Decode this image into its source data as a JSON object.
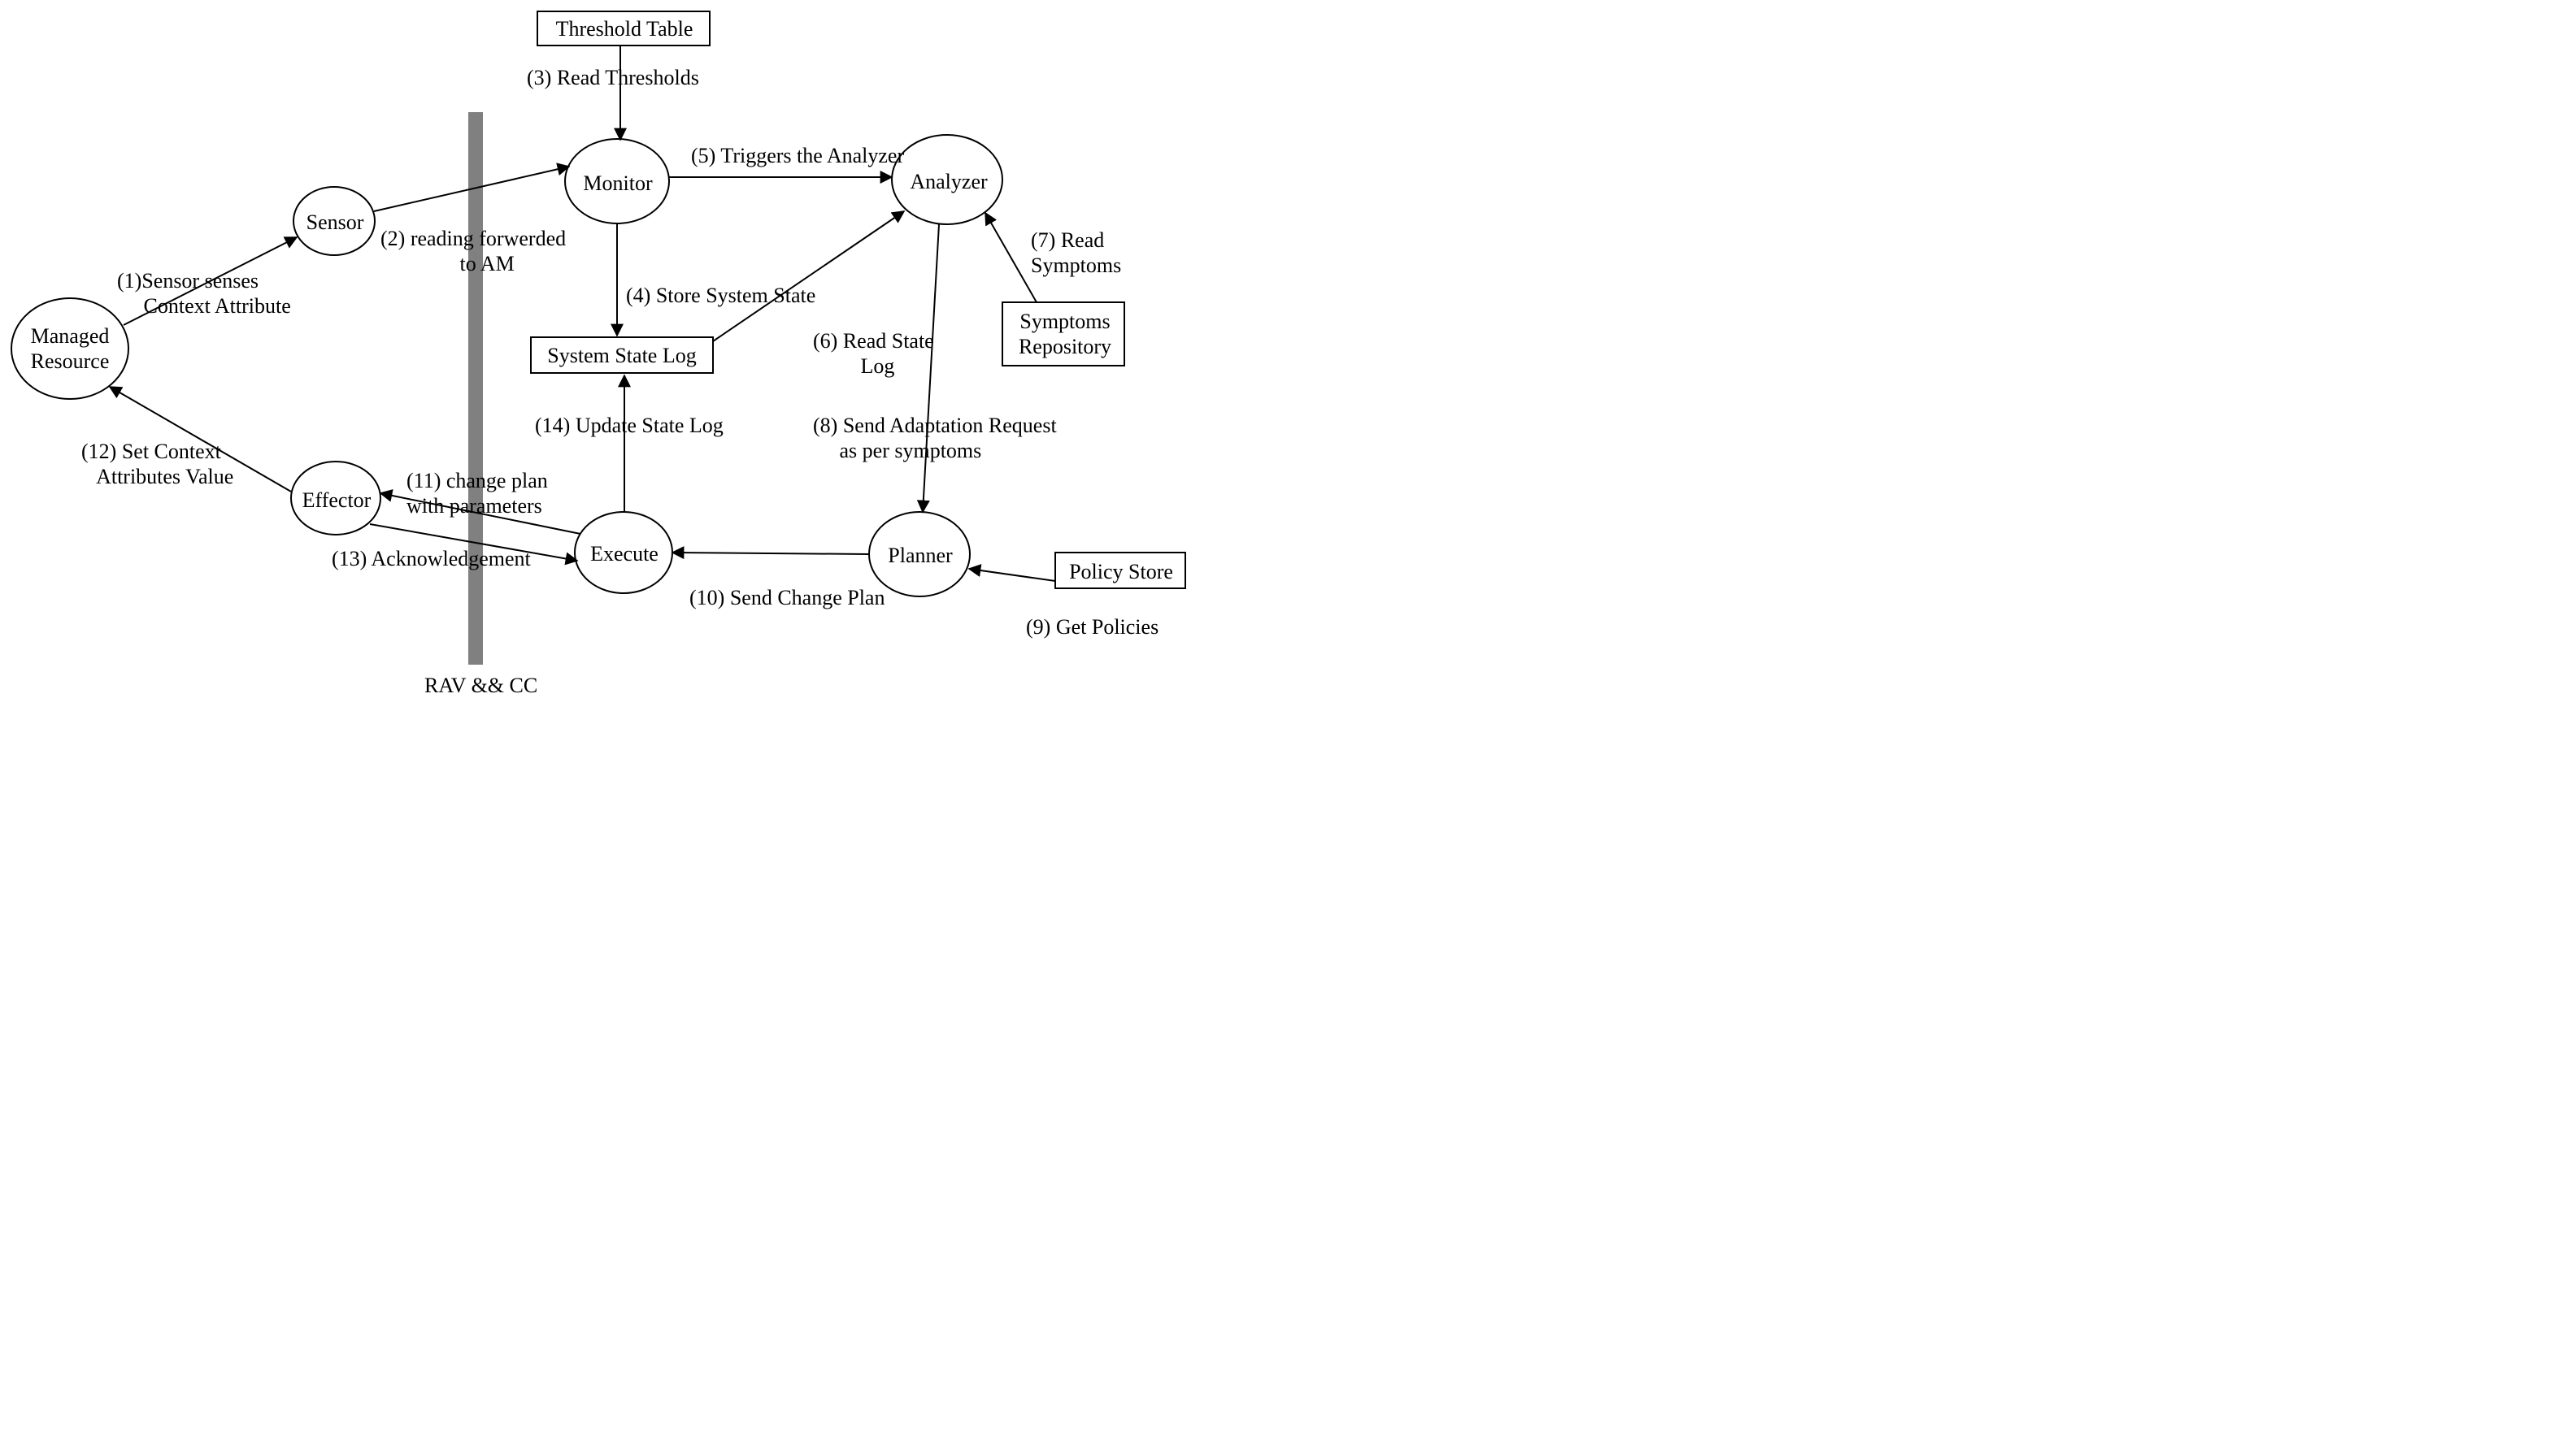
{
  "nodes": {
    "managed_resource": "Managed\nResource",
    "sensor": "Sensor",
    "effector": "Effector",
    "monitor": "Monitor",
    "analyzer": "Analyzer",
    "execute": "Execute",
    "planner": "Planner",
    "threshold_table": "Threshold Table",
    "system_state_log": "System State Log",
    "symptoms_repository": "Symptoms\nRepository",
    "policy_store": "Policy Store"
  },
  "edges": {
    "e1": "(1)Sensor senses\n     Context Attribute",
    "e2": "(2) reading forwerded\n               to AM",
    "e3": "(3) Read Thresholds",
    "e4": "(4) Store System State",
    "e5": "(5) Triggers the Analyzer",
    "e6": "(6) Read State\n         Log",
    "e7": "(7) Read\nSymptoms",
    "e8": "(8) Send Adaptation Request\n     as per symptoms",
    "e9": "(9) Get Policies",
    "e10": "(10) Send Change Plan",
    "e11": "(11) change plan\nwith parameters",
    "e12": "(12) Set Context\n   Attributes Value",
    "e13": "(13) Acknowledgement",
    "e14": "(14) Update State Log"
  },
  "barrier": "RAV && CC"
}
